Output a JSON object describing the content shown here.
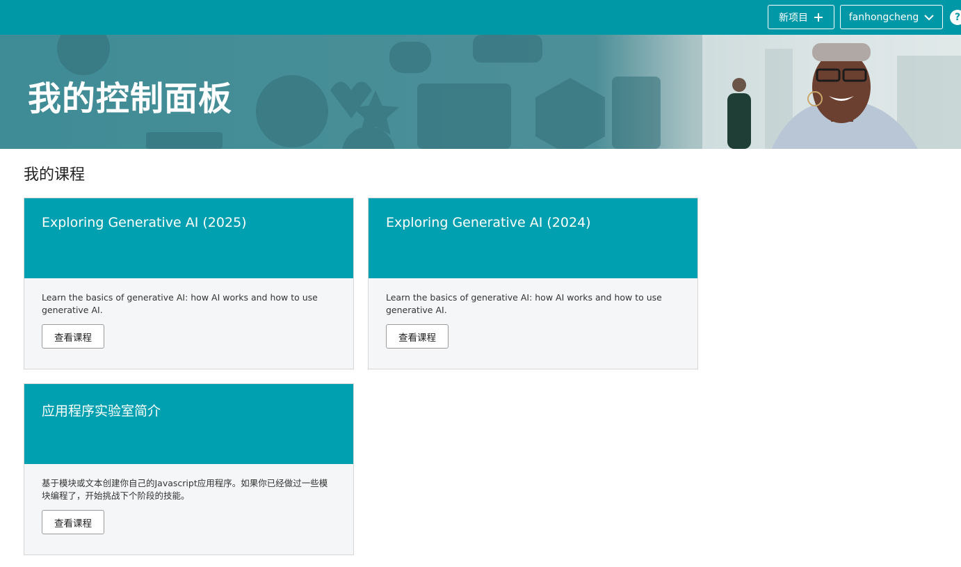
{
  "header": {
    "new_project_label": "新项目",
    "username": "fanhongcheng",
    "help_label": "?"
  },
  "banner": {
    "title": "我的控制面板"
  },
  "courses_section": {
    "title": "我的课程",
    "courses": [
      {
        "title": "Exploring Generative AI (2025)",
        "description": "Learn the basics of generative AI: how AI works and how to use generative AI.",
        "button_label": "查看课程"
      },
      {
        "title": "Exploring Generative AI (2024)",
        "description": "Learn the basics of generative AI: how AI works and how to use generative AI.",
        "button_label": "查看课程"
      },
      {
        "title": "应用程序实验室简介",
        "description": "基于模块或文本创建你自己的Javascript应用程序。如果你已经做过一些模块编程了，开始挑战下个阶段的技能。",
        "button_label": "查看课程"
      }
    ]
  },
  "colors": {
    "header_bg": "#0097a7",
    "card_header_bg": "#00a0b0",
    "card_body_bg": "#f5f6f7"
  }
}
